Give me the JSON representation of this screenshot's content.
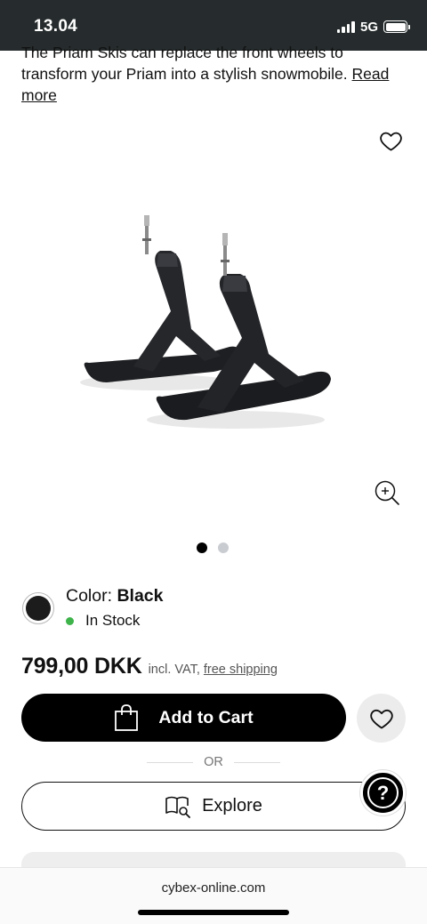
{
  "status_bar": {
    "time": "13.04",
    "network": "5G"
  },
  "product": {
    "description_line1": "The Priam Skis can replace the front wheels to",
    "description_line2": "transform your Priam into a stylish snowmobile.",
    "read_more_1": "Read",
    "read_more_2": "more",
    "image_icon": "priam-skis-image",
    "carousel": {
      "total": 2,
      "active": 1
    },
    "color_label": "Color:",
    "color_value": "Black",
    "swatch_color": "#1c1c1c",
    "stock_status": "In Stock",
    "stock_color": "#3db34a",
    "price": "799,00 DKK",
    "price_note": "incl. VAT,",
    "shipping_link": "free shipping"
  },
  "actions": {
    "add_to_cart": "Add to Cart",
    "or_label": "OR",
    "explore": "Explore",
    "help_icon": "question-mark-icon"
  },
  "browser": {
    "url": "cybex-online.com"
  }
}
